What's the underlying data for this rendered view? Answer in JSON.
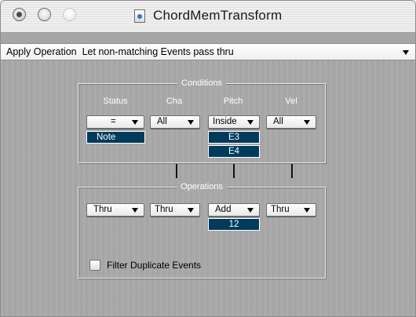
{
  "window": {
    "title": "ChordMemTransform"
  },
  "apply_operation": {
    "label": "Apply Operation",
    "selected": "Let non-matching Events pass thru"
  },
  "conditions": {
    "legend": "Conditions",
    "columns": [
      "Status",
      "Cha",
      "Pitch",
      "Vel"
    ],
    "popups": [
      "=",
      "All",
      "Inside",
      "All"
    ],
    "status_value": "Note",
    "pitch_low": "E3",
    "pitch_high": "E4"
  },
  "operations": {
    "legend": "Operations",
    "popups": [
      "Thru",
      "Thru",
      "Add",
      "Thru"
    ],
    "pitch_value": "12"
  },
  "filter_duplicates": {
    "label": "Filter Duplicate Events",
    "checked": false
  },
  "colors": {
    "value_box_bg": "#003b5c",
    "panel_bg": "#a8a8a8"
  }
}
